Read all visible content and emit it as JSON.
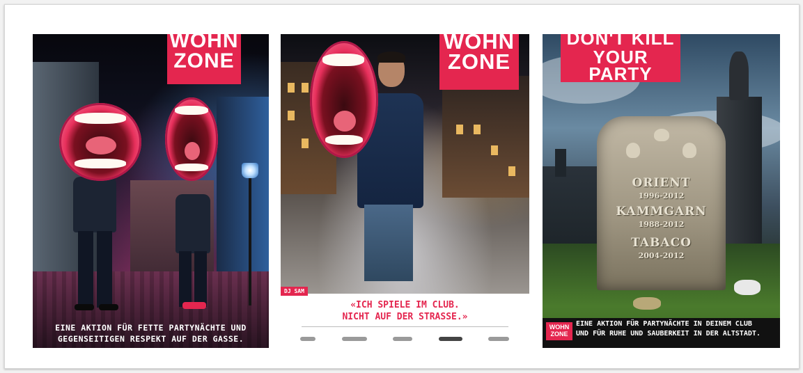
{
  "posters": [
    {
      "logo": [
        "WOHN",
        "ZONE"
      ],
      "bottom_text": [
        "EINE AKTION FÜR FETTE PARTYNÄCHTE UND",
        "GEGENSEITIGEN RESPEKT AUF DER GASSE."
      ]
    },
    {
      "logo": [
        "WOHN",
        "ZONE"
      ],
      "tag": "DJ SAM",
      "quote": [
        "«ICH SPIELE IM CLUB.",
        "NICHT AUF DER STRASSE.»"
      ]
    },
    {
      "logo": [
        "DON'T KILL",
        "YOUR PARTY"
      ],
      "mini_logo": [
        "WOHN",
        "ZONE"
      ],
      "tombstone": [
        {
          "name": "ORIENT",
          "years": "1996-2012"
        },
        {
          "name": "KAMMGARN",
          "years": "1988-2012"
        },
        {
          "name": "TABACO",
          "years": "2004-2012"
        }
      ],
      "bottom_text": [
        "EINE AKTION FÜR PARTYNÄCHTE IN DEINEM CLUB",
        "UND FÜR RUHE UND SAUBERKEIT IN DER ALTSTADT."
      ]
    }
  ],
  "colors": {
    "brand_red": "#e4264f"
  }
}
